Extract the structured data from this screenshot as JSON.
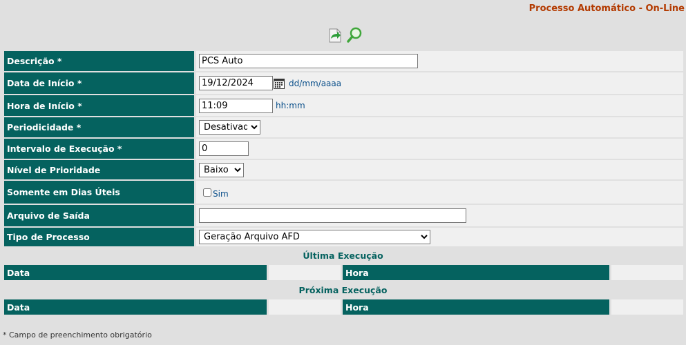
{
  "header": {
    "title": "Processo Automático - On-Line"
  },
  "toolbar": {
    "save_icon": "save-export-icon",
    "search_icon": "search-icon"
  },
  "form": {
    "descricao": {
      "label": "Descrição *",
      "value": "PCS Auto"
    },
    "data_inicio": {
      "label": "Data de Início *",
      "value": "19/12/2024",
      "hint": "dd/mm/aaaa"
    },
    "hora_inicio": {
      "label": "Hora de Início *",
      "value": "11:09",
      "hint": "hh:mm"
    },
    "periodicidade": {
      "label": "Periodicidade *",
      "selected": "Desativado"
    },
    "intervalo": {
      "label": "Intervalo de Execução *",
      "value": "0"
    },
    "prioridade": {
      "label": "Nível de Prioridade",
      "selected": "Baixo"
    },
    "dias_uteis": {
      "label": "Somente em Dias Úteis",
      "option": "Sim",
      "checked": false
    },
    "arquivo_saida": {
      "label": "Arquivo de Saída",
      "value": ""
    },
    "tipo_processo": {
      "label": "Tipo de Processo",
      "selected": "Geração Arquivo AFD"
    }
  },
  "ultima_execucao": {
    "title": "Última Execução",
    "data_label": "Data",
    "hora_label": "Hora",
    "data_value": "",
    "hora_value": ""
  },
  "proxima_execucao": {
    "title": "Próxima Execução",
    "data_label": "Data",
    "hora_label": "Hora",
    "data_value": "",
    "hora_value": ""
  },
  "footnote": "* Campo de preenchimento obrigatório",
  "colors": {
    "label_bg": "#05625f",
    "value_bg": "#f0f0f0",
    "title": "#b33a00",
    "hint": "#0a4f8a"
  }
}
